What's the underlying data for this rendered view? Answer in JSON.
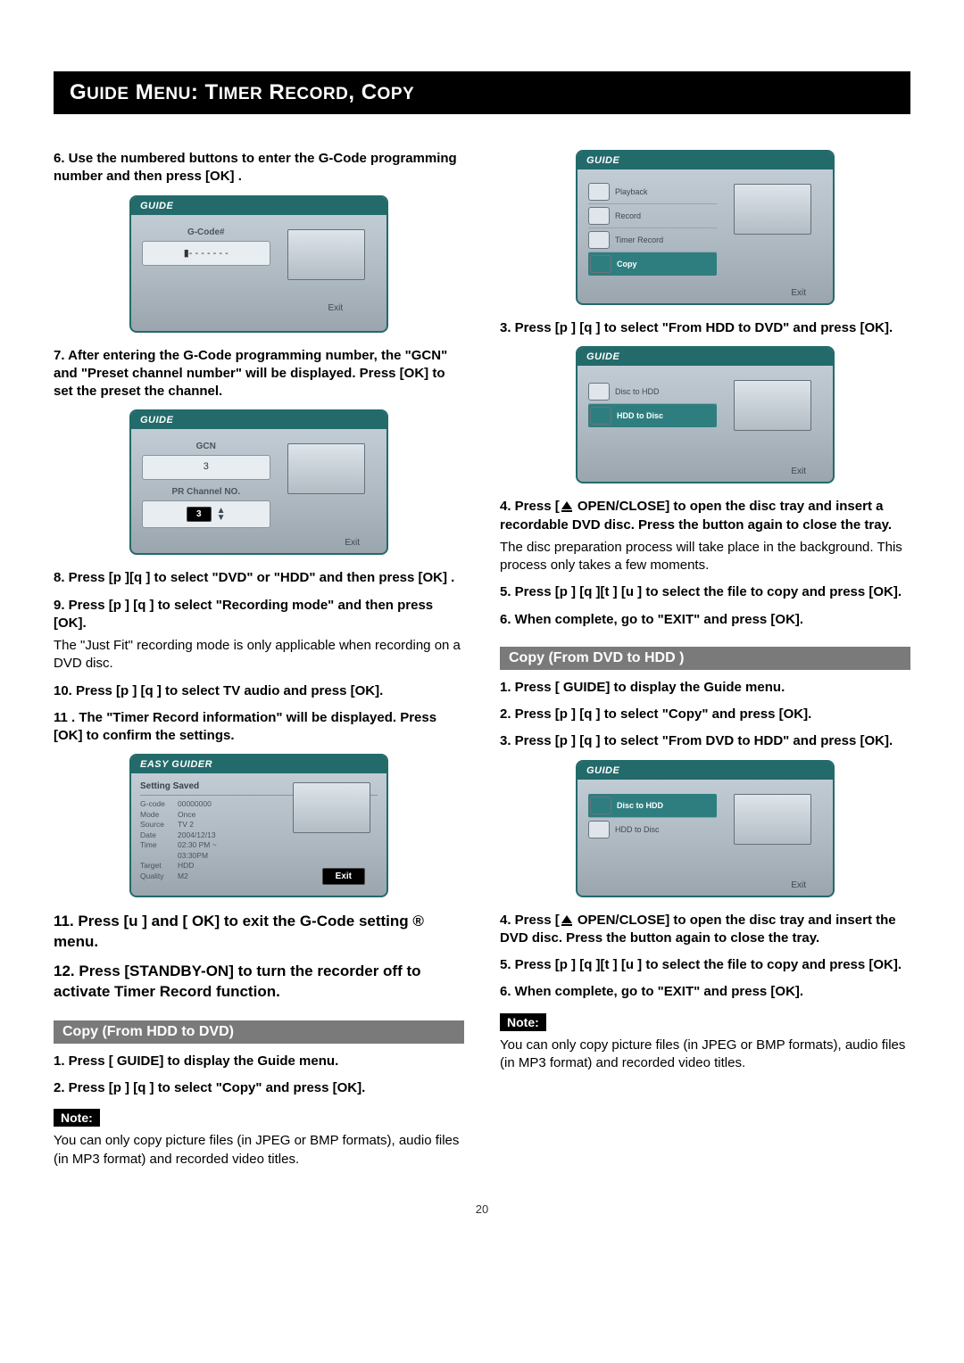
{
  "title": {
    "g": "G",
    "uide": "UIDE",
    "m": "M",
    "enu": "ENU",
    "t": "T",
    "imer": "IMER",
    "r": "R",
    "ecord": "ECORD",
    "c": "C",
    "opy": "OPY"
  },
  "left": {
    "step6": "6.  Use the numbered buttons to enter the G-Code programming number and then press [OK] .",
    "fig1": {
      "header": "GUIDE",
      "field_label": "G-Code#",
      "field_value": "▮- - - - - - -",
      "exit": "Exit"
    },
    "step7": "7.  After entering the G-Code programming number, the \"GCN\" and \"Preset channel number\" will be displayed.  Press [OK] to set the preset the channel.",
    "fig2": {
      "header": "GUIDE",
      "gcn_label": "GCN",
      "gcn_value": "3",
      "pr_label": "PR Channel NO.",
      "pr_value": "3",
      "exit": "Exit"
    },
    "step8": "8.  Press [p ][q ] to select \"DVD\" or \"HDD\" and then press [OK] .",
    "step9": "9.  Press [p ]  [q  ] to select \"Recording mode\" and then press [OK].",
    "note9": "The \"Just Fit\" recording mode is only applicable when recording on a DVD disc.",
    "step10": "10. Press [p ]  [q  ] to select TV audio and press [OK].",
    "step10b": "11 . The \"Timer Record information\" will be displayed. Press [OK] to confirm the settings.",
    "fig3": {
      "header": "EASY GUIDER",
      "saved": "Setting Saved",
      "rows": [
        {
          "k": "G-code",
          "v": "00000000"
        },
        {
          "k": "Mode",
          "v": "Once"
        },
        {
          "k": "Source",
          "v": "TV   2"
        },
        {
          "k": "Date",
          "v": "2004/12/13"
        },
        {
          "k": "Time",
          "v": "02:30 PM ~"
        },
        {
          "k": "",
          "v": "03:30PM"
        },
        {
          "k": "Target",
          "v": "HDD"
        },
        {
          "k": "Quality",
          "v": "M2"
        }
      ],
      "exit": "Exit"
    },
    "step11": "11. Press [u ]   and [ OK] to exit the G-Code setting ® menu.",
    "step12": "12. Press [STANDBY-ON] to turn the recorder off to activate Timer Record function.",
    "section": "Copy (From HDD to DVD)",
    "c1": "1.  Press [      GUIDE] to display the Guide menu.",
    "c2": "2.  Press [p ]  [q  ] to select \"Copy\" and press [OK].",
    "note_label": "Note:",
    "note_body": "You can only copy picture files (in JPEG or BMP formats), audio files (in MP3 format) and recorded video titles."
  },
  "right": {
    "fig4": {
      "header": "GUIDE",
      "items": [
        "Playback",
        "Record",
        "Timer Record",
        "Copy"
      ],
      "selected": 3,
      "exit": "Exit"
    },
    "step3": "3.  Press  [p ]  [q  ] to select \"From HDD to DVD\" and press [OK].",
    "fig5": {
      "header": "GUIDE",
      "items": [
        "Disc to HDD",
        "HDD to Disc"
      ],
      "selected": 1,
      "exit": "Exit"
    },
    "step4a": "4.  Press [",
    "step4b": " OPEN/CLOSE] to open the disc tray and insert a recordable DVD disc. Press the button again to close the tray.",
    "step4note": "The disc preparation process will take place in the background. This process only takes a few moments.",
    "step5": "5. Press [p ] [q ][t  ] [u ] to select the file to copy and press [OK].",
    "step6": "6.  When complete, go to \"EXIT\" and press [OK].",
    "section": "Copy (From DVD to HDD )",
    "d1": "1.  Press [      GUIDE] to display the Guide menu.",
    "d2": "2.  Press [p ]  [q  ] to select \"Copy\" and press [OK].",
    "d3": "3.  Press  [p ]  [q  ] to select \"From DVD to HDD\" and press [OK].",
    "fig6": {
      "header": "GUIDE",
      "items": [
        "Disc to HDD",
        "HDD to Disc"
      ],
      "selected": 0,
      "exit": "Exit"
    },
    "d4a": "4.  Press [",
    "d4b": " OPEN/CLOSE] to open the disc tray and insert the DVD disc. Press the button again to close the tray.",
    "d5": "5. Press [p ] [q ][t  ] [u ] to select the file to copy and press [OK].",
    "d6": "6.  When complete, go to \"EXIT\" and press [OK].",
    "note_label": "Note:",
    "note_body": "You can only copy picture files (in JPEG or BMP formats), audio files (in MP3 format) and recorded video titles."
  },
  "page": "20"
}
